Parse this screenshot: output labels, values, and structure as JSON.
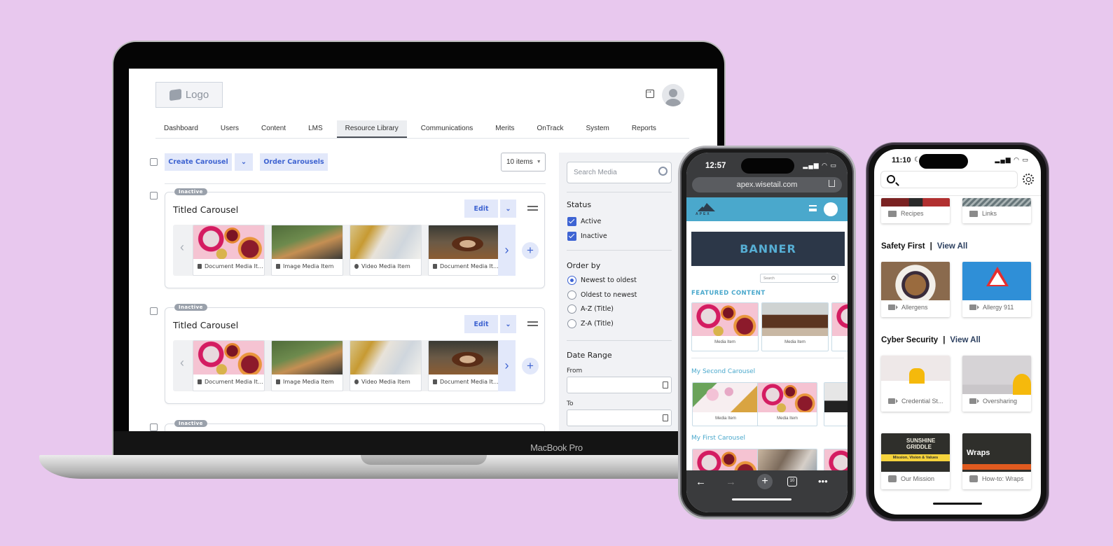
{
  "laptop": {
    "brand_label": "MacBook Pro",
    "app": {
      "logo_text": "Logo",
      "header_icons": [
        "sign-out-icon",
        "user-avatar"
      ],
      "nav": {
        "active": "Resource Library",
        "items": [
          "Dashboard",
          "Users",
          "Content",
          "LMS",
          "Resource Library",
          "Communications",
          "Merits",
          "OnTrack",
          "System",
          "Reports"
        ]
      },
      "toolbar": {
        "create_label": "Create Carousel",
        "order_label": "Order Carousels",
        "page_size": "10 items"
      },
      "carousels": [
        {
          "status": "Inactive",
          "title": "Titled Carousel",
          "edit_label": "Edit",
          "items": [
            {
              "type": "document",
              "label": "Document Media It..."
            },
            {
              "type": "image",
              "label": "Image Media Item"
            },
            {
              "type": "video",
              "label": "Video Media Item"
            },
            {
              "type": "document",
              "label": "Document Media It..."
            }
          ]
        },
        {
          "status": "Inactive",
          "title": "Titled Carousel",
          "edit_label": "Edit",
          "items": [
            {
              "type": "document",
              "label": "Document Media It..."
            },
            {
              "type": "image",
              "label": "Image Media Item"
            },
            {
              "type": "video",
              "label": "Video Media Item"
            },
            {
              "type": "document",
              "label": "Document Media It..."
            }
          ]
        },
        {
          "status": "Inactive"
        }
      ],
      "filters": {
        "search_placeholder": "Search Media",
        "status_heading": "Status",
        "status_options": [
          {
            "label": "Active",
            "checked": true
          },
          {
            "label": "Inactive",
            "checked": true
          }
        ],
        "order_heading": "Order by",
        "order_options": [
          "Newest to oldest",
          "Oldest to newest",
          "A-Z (Title)",
          "Z-A (Title)"
        ],
        "order_selected": "Newest to oldest",
        "date_heading": "Date Range",
        "from_label": "From",
        "to_label": "To",
        "from_value": "",
        "to_value": ""
      }
    }
  },
  "phone_browser": {
    "time": "12:57",
    "url": "apex.wisetail.com",
    "brand": "APEX",
    "banner": "BANNER",
    "search_placeholder": "Search",
    "sections": [
      {
        "title": "FEATURED CONTENT",
        "items": [
          "Media Item",
          "Media Item"
        ]
      },
      {
        "title": "My Second Carousel",
        "items": [
          "Media Item",
          "Media Item"
        ]
      },
      {
        "title": "My First Carousel",
        "items": []
      }
    ],
    "tab_count": "10"
  },
  "phone_app": {
    "time": "11:10",
    "top_items": [
      {
        "type": "folder",
        "label": "Recipes"
      },
      {
        "type": "folder",
        "label": "Links"
      }
    ],
    "sections": [
      {
        "title": "Safety First",
        "link": "View All",
        "items": [
          {
            "type": "video",
            "label": "Allergens"
          },
          {
            "type": "video",
            "label": "Allergy 911"
          }
        ]
      },
      {
        "title": "Cyber Security",
        "link": "View All",
        "items": [
          {
            "type": "video",
            "label": "Credential St..."
          },
          {
            "type": "video",
            "label": "Oversharing"
          }
        ]
      },
      {
        "title": "",
        "items": [
          {
            "type": "image",
            "label": "Our Mission"
          },
          {
            "type": "image",
            "label": "How-to: Wraps"
          }
        ]
      }
    ],
    "thumb_text": {
      "sunshine": "SUNSHINE GRIDDLE",
      "sunshine_band": "Mission, Vision & Values",
      "wraps": "Wraps"
    }
  },
  "colors": {
    "background": "#e8c8ee",
    "accent_blue": "#3d63d3",
    "soft_button": "#e2e8fa",
    "apex_blue": "#4aa8cc",
    "banner_navy": "#2c3748"
  }
}
